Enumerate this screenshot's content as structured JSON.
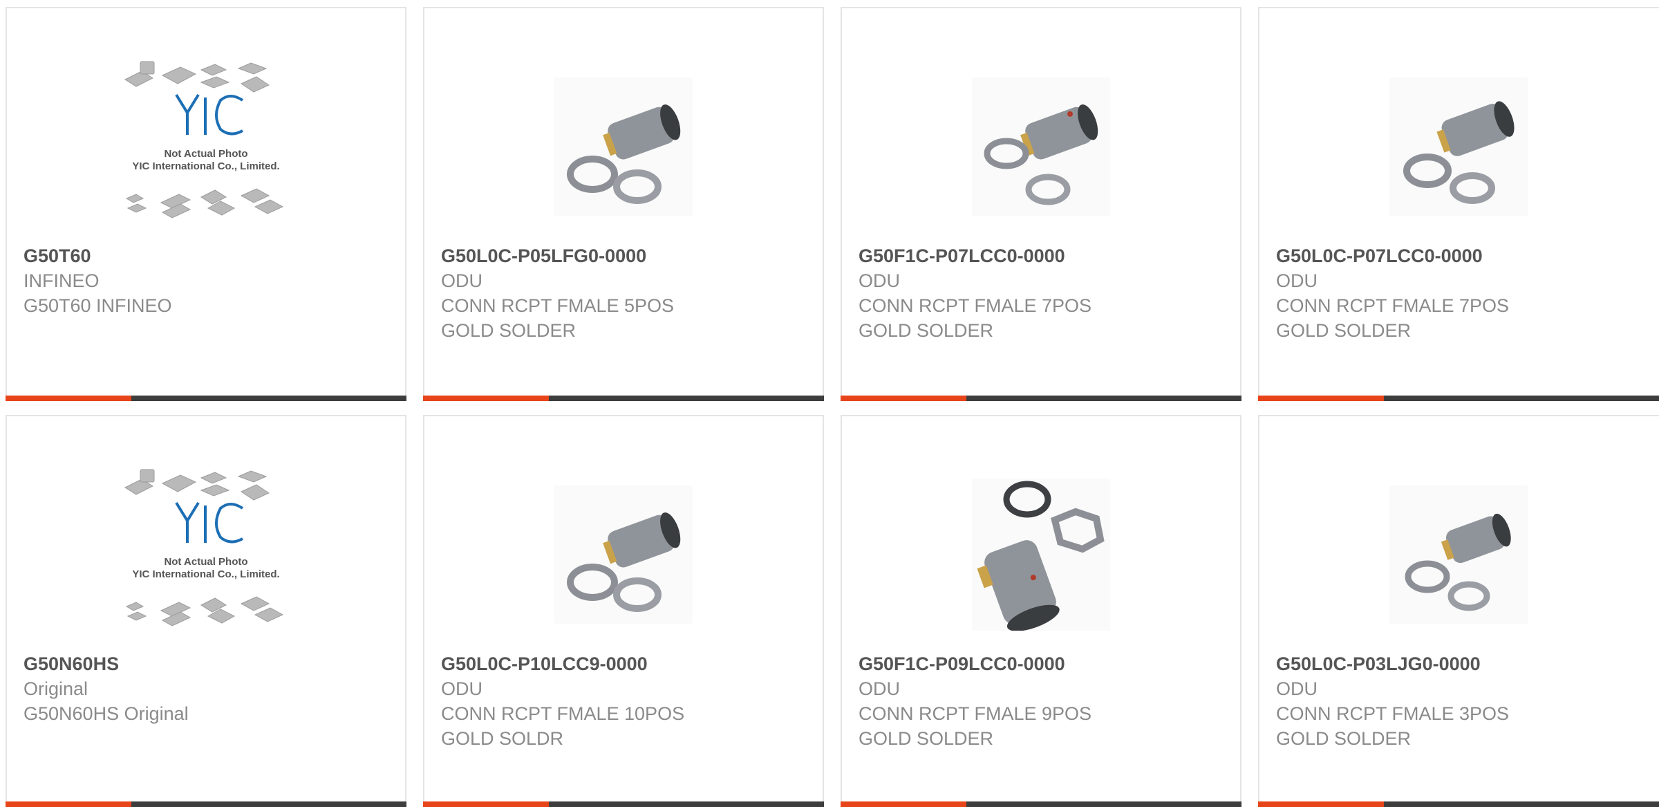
{
  "colors": {
    "accent": "#e8441a",
    "bar": "#3d3d3d",
    "border": "#e4e4e4",
    "title": "#555555",
    "text": "#8a8a8a",
    "yic_blue": "#1d6fb5"
  },
  "placeholder": {
    "brand": "YIC",
    "caption_1": "Not Actual Photo",
    "caption_2": "YIC International Co., Limited."
  },
  "products": [
    {
      "part": "G50T60",
      "line1": "INFINEO",
      "line2": "G50T60 INFINEO",
      "line3": "",
      "image": "yic-placeholder"
    },
    {
      "part": "G50L0C-P05LFG0-0000",
      "line1": "ODU",
      "line2": "CONN RCPT FMALE 5POS",
      "line3": "GOLD SOLDER",
      "image": "connector-photo"
    },
    {
      "part": "G50F1C-P07LCC0-0000",
      "line1": "ODU",
      "line2": "CONN RCPT FMALE 7POS",
      "line3": "GOLD SOLDER",
      "image": "connector-photo"
    },
    {
      "part": "G50L0C-P07LCC0-0000",
      "line1": "ODU",
      "line2": "CONN RCPT FMALE 7POS",
      "line3": "GOLD SOLDER",
      "image": "connector-photo"
    },
    {
      "part": "G50N60HS",
      "line1": "Original",
      "line2": "G50N60HS Original",
      "line3": "",
      "image": "yic-placeholder"
    },
    {
      "part": "G50L0C-P10LCC9-0000",
      "line1": "ODU",
      "line2": "CONN RCPT FMALE 10POS",
      "line3": "GOLD SOLDR",
      "image": "connector-photo"
    },
    {
      "part": "G50F1C-P09LCC0-0000",
      "line1": "ODU",
      "line2": "CONN RCPT FMALE 9POS",
      "line3": "GOLD SOLDER",
      "image": "connector-photo-large"
    },
    {
      "part": "G50L0C-P03LJG0-0000",
      "line1": "ODU",
      "line2": "CONN RCPT FMALE 3POS",
      "line3": "GOLD SOLDER",
      "image": "connector-photo"
    }
  ]
}
